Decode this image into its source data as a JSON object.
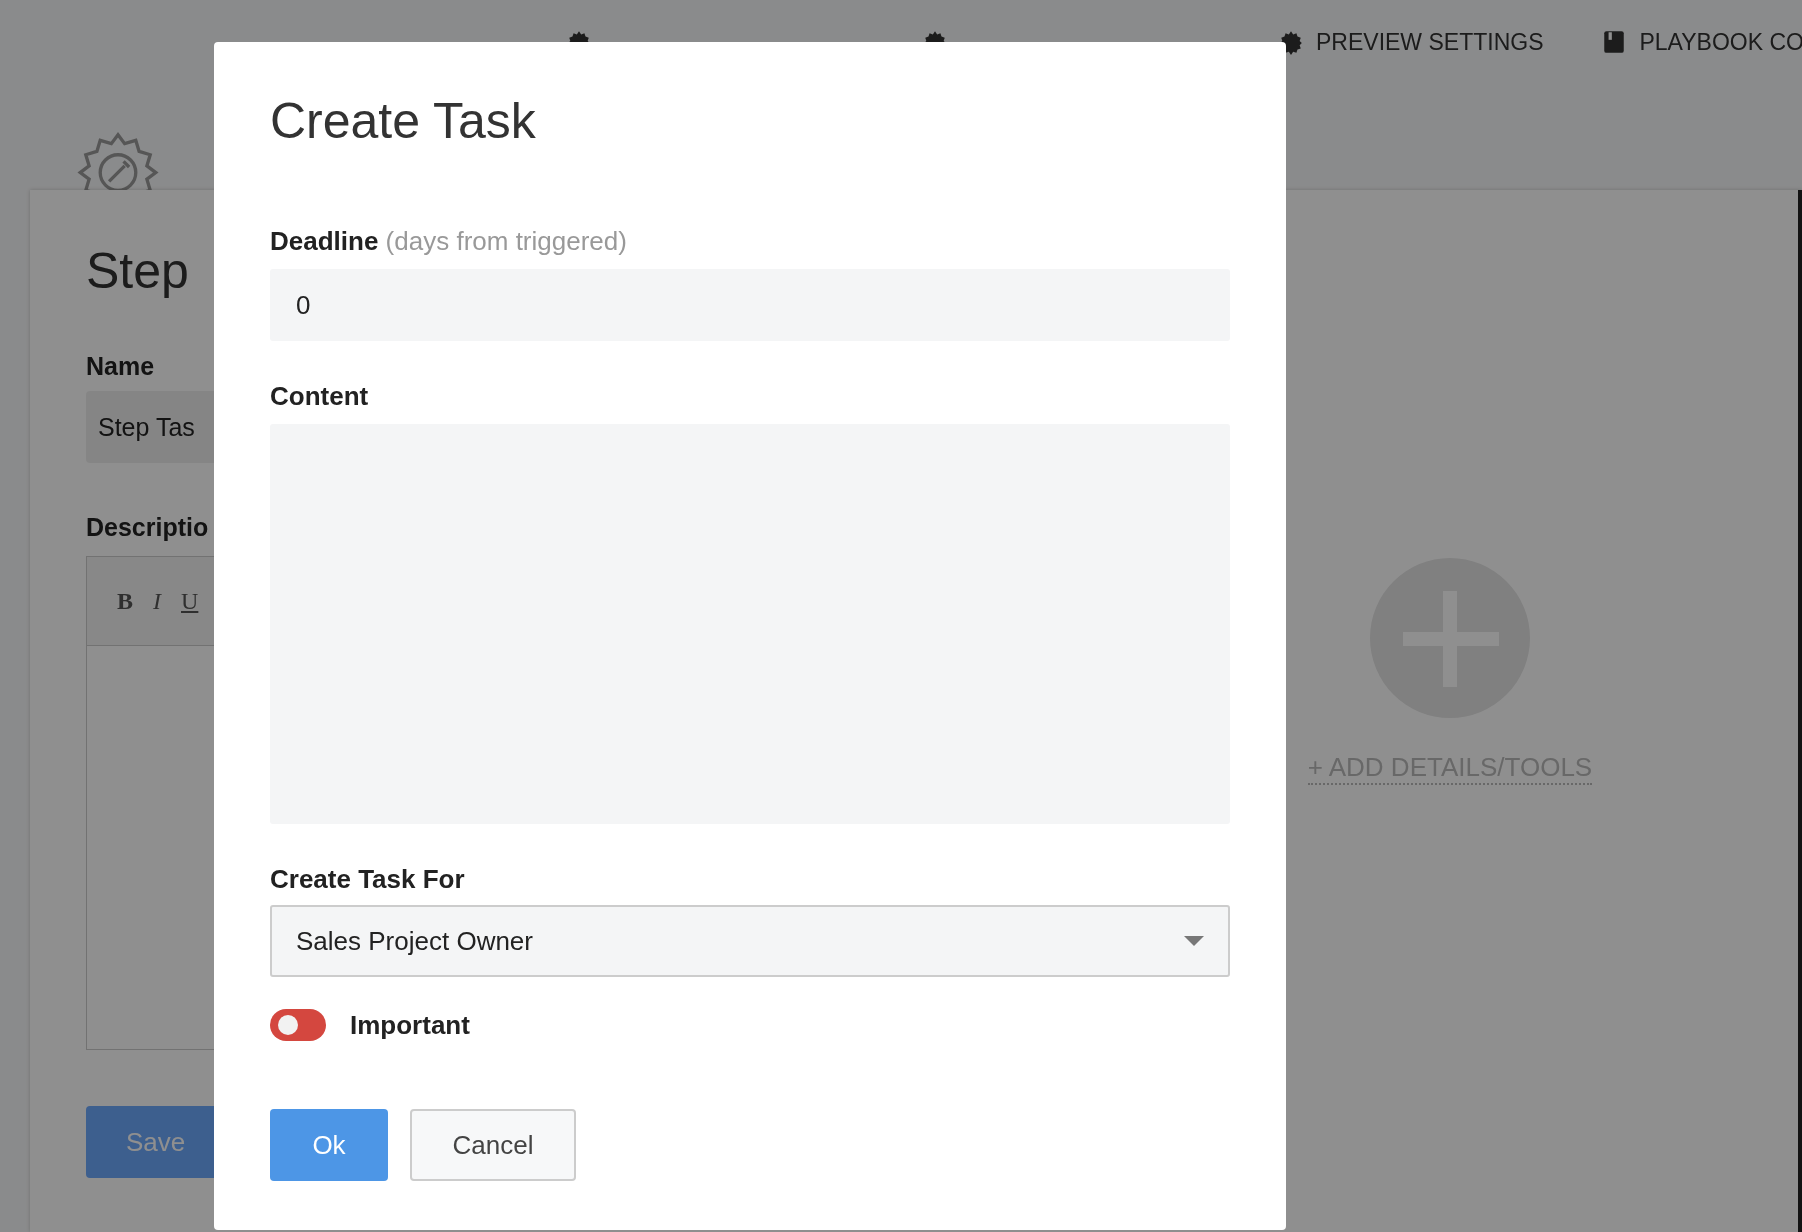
{
  "top_nav": [
    {
      "kind": "gear"
    },
    {
      "kind": "gear"
    },
    {
      "label": "PREVIEW SETTINGS",
      "kind": "gear"
    },
    {
      "label": "PLAYBOOK CO",
      "kind": "book"
    }
  ],
  "step_panel": {
    "title": "Step",
    "name_label": "Name",
    "name_value": "Step Tas",
    "description_label": "Descriptio",
    "toolbar": [
      {
        "label": "B",
        "kind": "bold"
      },
      {
        "label": "I",
        "kind": "italic"
      },
      {
        "label": "U",
        "kind": "underline"
      }
    ],
    "save_button": "Save",
    "add_details": "+ ADD DETAILS/TOOLS"
  },
  "dialog": {
    "title": "Create Task",
    "deadline": {
      "label": "Deadline",
      "hint": "(days from triggered)",
      "value": "0"
    },
    "content": {
      "label": "Content"
    },
    "create_for": {
      "label": "Create Task For",
      "value": "Sales Project Owner"
    },
    "important": {
      "label": "Important",
      "on": false
    },
    "buttons": [
      {
        "label": "Ok",
        "kind": "primary"
      },
      {
        "label": "Cancel",
        "kind": "secondary"
      }
    ]
  }
}
